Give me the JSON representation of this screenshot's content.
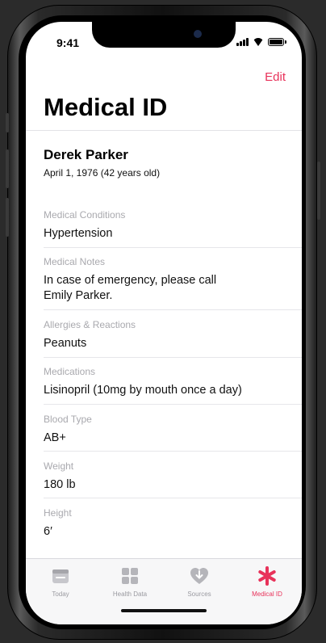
{
  "status": {
    "time": "9:41"
  },
  "header": {
    "edit_label": "Edit",
    "title": "Medical ID"
  },
  "person": {
    "name": "Derek Parker",
    "dob": "April 1, 1976 (42 years old)"
  },
  "fields": [
    {
      "label": "Medical Conditions",
      "value": "Hypertension"
    },
    {
      "label": "Medical Notes",
      "value": "In case of emergency, please call Emily Parker."
    },
    {
      "label": "Allergies & Reactions",
      "value": "Peanuts"
    },
    {
      "label": "Medications",
      "value": "Lisinopril (10mg by mouth once a day)"
    },
    {
      "label": "Blood Type",
      "value": "AB+"
    },
    {
      "label": "Weight",
      "value": "180 lb"
    },
    {
      "label": "Height",
      "value": "6′"
    }
  ],
  "tabs": [
    {
      "label": "Today",
      "icon": "calendar-icon",
      "active": false
    },
    {
      "label": "Health Data",
      "icon": "grid-icon",
      "active": false
    },
    {
      "label": "Sources",
      "icon": "heart-download-icon",
      "active": false
    },
    {
      "label": "Medical ID",
      "icon": "asterisk-icon",
      "active": true
    }
  ],
  "colors": {
    "accent": "#e8325a",
    "label_gray": "#a9a9ae",
    "tab_gray": "#9a9aa0"
  }
}
